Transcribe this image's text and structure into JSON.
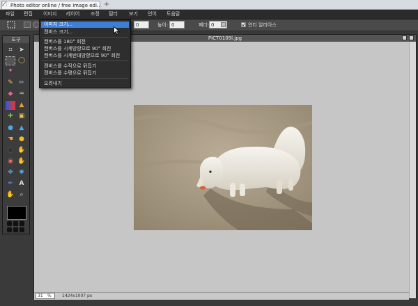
{
  "browser": {
    "tab_title": "Photo editor online / free image edi…",
    "new_tab_symbol": "+"
  },
  "menubar": {
    "items": [
      "파일",
      "편집",
      "이미지",
      "레이어",
      "조정",
      "필터",
      "보기",
      "언어",
      "도움말"
    ]
  },
  "options": {
    "width_value": "0",
    "height_label": "높이:",
    "height_value": "0",
    "feather_label": "페더:",
    "feather_value": "0",
    "antialias_label": "안티 알리아스"
  },
  "toolbox": {
    "title": "도구"
  },
  "image_menu": {
    "items": [
      "이미지 크기...",
      "캔버스 크기...",
      "캔버스를 180° 회전",
      "캔버스를 시계방향으로 90° 회전",
      "캔버스를 시계반대방향으로 90° 회전",
      "캔버스를 수직으로 뒤집기",
      "캔버스를 수평으로 뒤집기",
      "오려내기"
    ],
    "highlighted_index": 0
  },
  "document": {
    "title": "PICT0109l.jpg",
    "zoom": "31",
    "zoom_unit": "%",
    "dimensions": "1424x1007 px"
  },
  "colors": {
    "foreground": "#000000",
    "menu_highlight": "#3d7ed6",
    "canvas_background": "#c6c6c6"
  }
}
